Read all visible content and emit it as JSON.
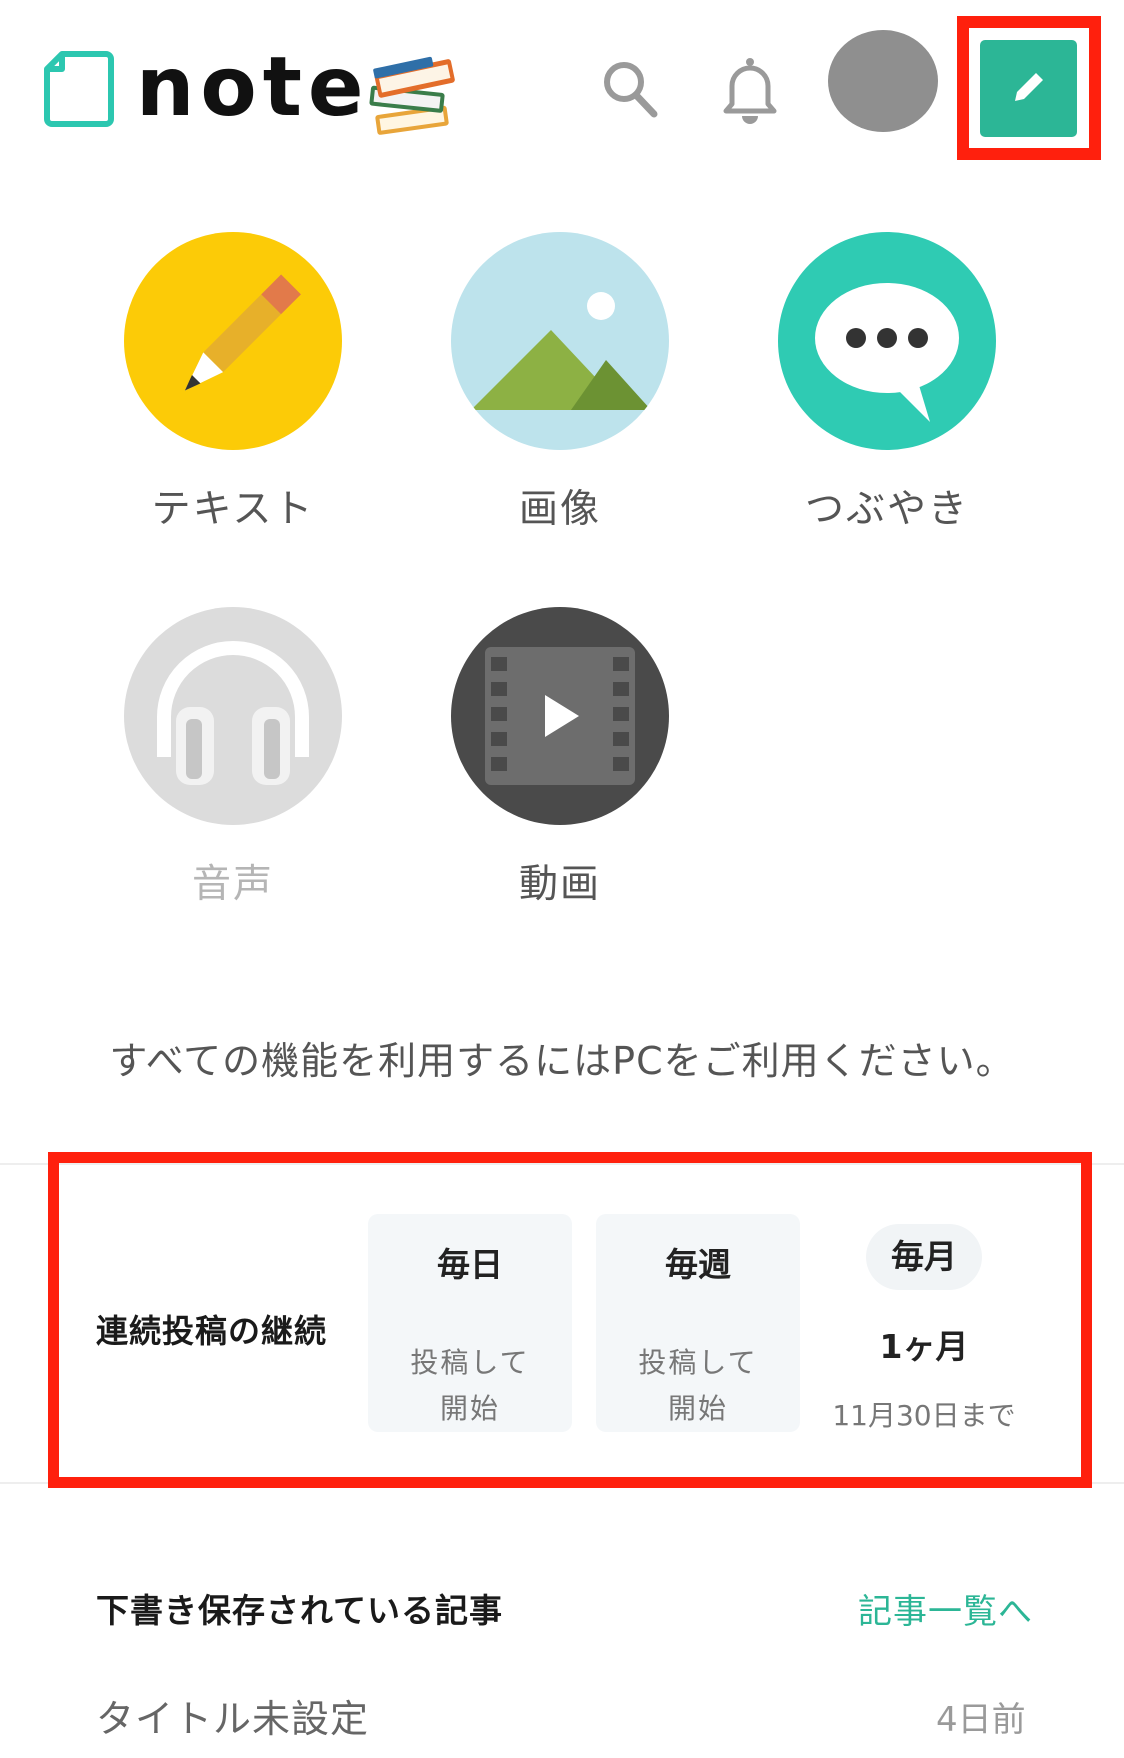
{
  "header": {
    "logo_text": "note",
    "icons": {
      "logo_mark": "note-logo-icon",
      "decoration": "books-icon",
      "search": "search-icon",
      "notifications": "bell-icon",
      "avatar": "avatar",
      "post": "pencil-icon"
    }
  },
  "create_menu": {
    "items": [
      {
        "label": "テキスト",
        "icon": "pencil-icon",
        "enabled": true
      },
      {
        "label": "画像",
        "icon": "image-icon",
        "enabled": true
      },
      {
        "label": "つぶやき",
        "icon": "speech-bubble-icon",
        "enabled": true
      },
      {
        "label": "音声",
        "icon": "headphones-icon",
        "enabled": false
      },
      {
        "label": "動画",
        "icon": "video-icon",
        "enabled": true
      }
    ]
  },
  "notice": "すべての機能を利用するにはPCをご利用ください。",
  "streak": {
    "title": "連続投稿の継続",
    "daily": {
      "label": "毎日",
      "status": "投稿して\n開始"
    },
    "weekly": {
      "label": "毎週",
      "status": "投稿して\n開始"
    },
    "monthly": {
      "label": "毎月",
      "value": "1ヶ月",
      "until": "11月30日まで"
    }
  },
  "drafts": {
    "title": "下書き保存されている記事",
    "link": "記事一覧へ",
    "items": [
      {
        "title": "タイトル未設定",
        "time": "4日前"
      }
    ]
  },
  "colors": {
    "accent": "#2cb696",
    "highlight": "#ff200d",
    "text_pencil_bg": "#fccb07",
    "image_bg": "#bde3ec",
    "mountain": "#8db144",
    "tsubuyaki_bg": "#2fcbb3",
    "audio_bg": "#dcdcdc",
    "video_bg": "#4a4a4a"
  }
}
